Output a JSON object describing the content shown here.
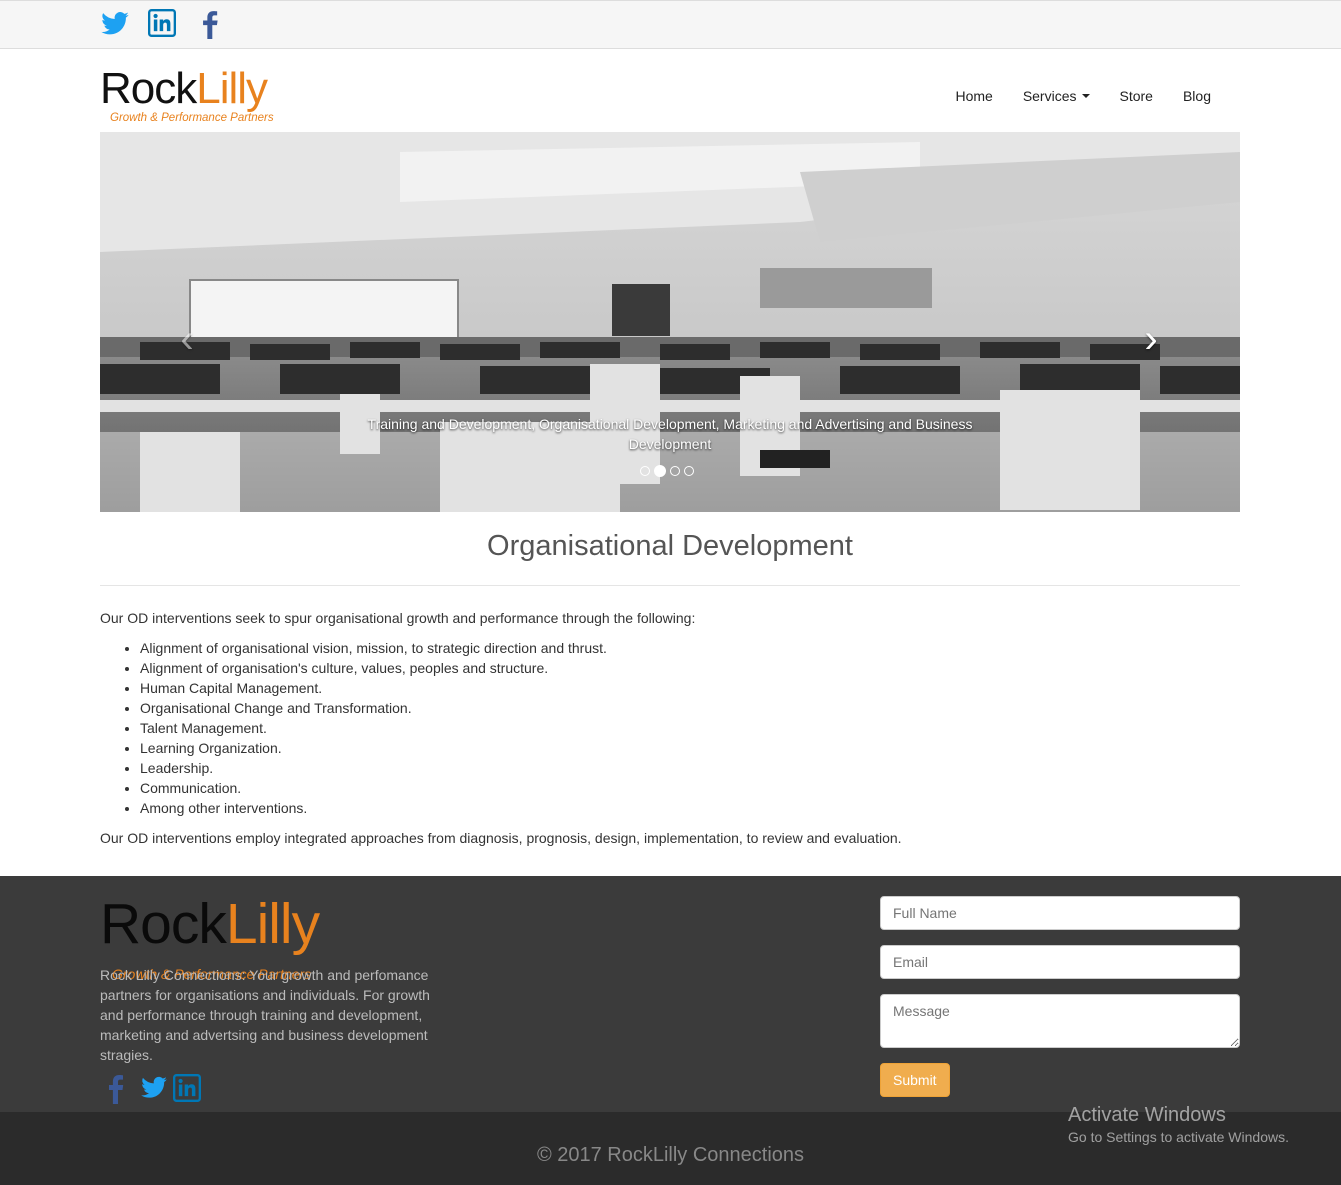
{
  "topbar": {
    "social": [
      {
        "icon": "twitter-icon",
        "color": "#1da1f2"
      },
      {
        "icon": "linkedin-icon",
        "color": "#0077b5"
      },
      {
        "icon": "facebook-icon",
        "color": "#3b5998"
      }
    ]
  },
  "brand": {
    "name_part1": "Rock",
    "name_part2": "Lilly",
    "tagline": "Growth & Performance Partners",
    "accent": "#e8821e"
  },
  "nav": {
    "items": [
      "Home",
      "Services",
      "Store",
      "Blog"
    ]
  },
  "carousel": {
    "caption": "Training and Development, Organisational Development, Marketing and Advertising and Business Development",
    "slide_count": 4,
    "active_index": 1,
    "prev_icon": "chevron-left-icon",
    "next_icon": "chevron-right-icon"
  },
  "main": {
    "title": "Organisational Development",
    "intro": "Our OD interventions seek to spur organisational growth and performance through the following:",
    "items": [
      "Alignment of organisational vision, mission, to strategic direction and thrust.",
      "Alignment of organisation's culture, values, peoples and structure.",
      "Human Capital Management.",
      "Organisational Change and Transformation.",
      "Talent Management.",
      "Learning Organization.",
      "Leadership.",
      "Communication.",
      "Among other interventions."
    ],
    "outro": "Our OD interventions employ integrated approaches from diagnosis, prognosis, design, implementation, to review and evaluation."
  },
  "footer": {
    "about": "Rock Lilly Connections: Your growth and perfomance partners for organisations and individuals. For growth and performance through training and development, marketing and advertsing and business development stragies.",
    "social": [
      {
        "icon": "facebook-icon",
        "color": "#3b5998"
      },
      {
        "icon": "twitter-icon",
        "color": "#1da1f2"
      },
      {
        "icon": "linkedin-icon",
        "color": "#0077b5"
      }
    ],
    "form": {
      "name_placeholder": "Full Name",
      "email_placeholder": "Email",
      "message_placeholder": "Message",
      "submit_label": "Submit",
      "submit_color": "#f0ad4e"
    },
    "copyright": "© 2017 RockLilly Connections"
  },
  "overlay": {
    "activate_title": "Activate Windows",
    "activate_sub": "Go to Settings to activate Windows."
  }
}
